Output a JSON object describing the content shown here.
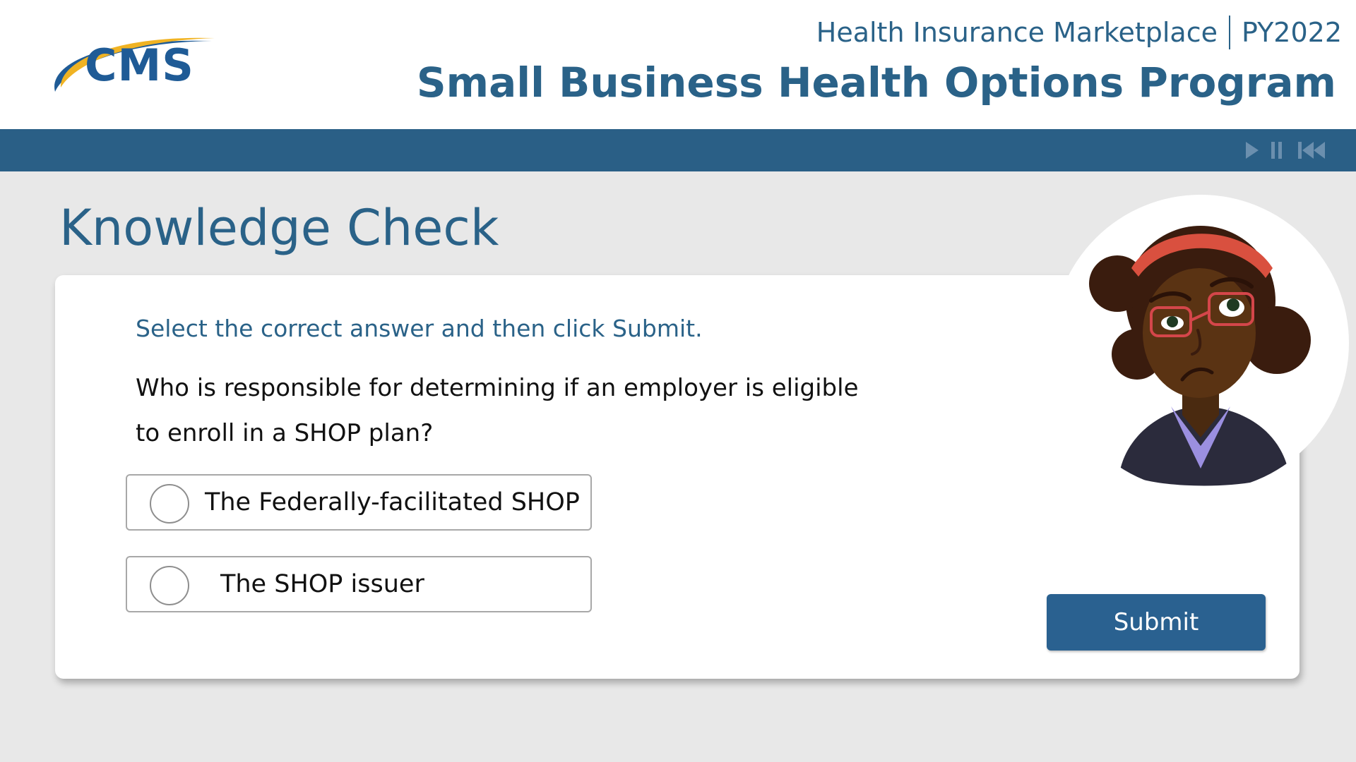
{
  "header": {
    "logo_text": "CMS",
    "marketplace": "Health Insurance Marketplace",
    "plan_year": "PY2022",
    "program_title": "Small Business Health Options Program"
  },
  "player_controls": {
    "play_icon": "play-icon",
    "pause_icon": "pause-icon",
    "rewind_icon": "rewind-icon"
  },
  "page": {
    "section_title": "Knowledge Check"
  },
  "quiz": {
    "instruction": "Select the correct answer and then click Submit.",
    "question_line1": "Who is responsible for determining if an employer is eligible",
    "question_line2": "to enroll in a SHOP plan?",
    "options": [
      {
        "label": "The Federally-facilitated SHOP",
        "selected": false
      },
      {
        "label": "The SHOP issuer",
        "selected": false
      }
    ],
    "submit_label": "Submit"
  },
  "colors": {
    "brand_blue": "#2a6288",
    "nav_bar": "#2a5f86",
    "button": "#2a6190",
    "background": "#e8e8e8",
    "logo_gold": "#f0b323",
    "logo_blue": "#1f5b96"
  }
}
